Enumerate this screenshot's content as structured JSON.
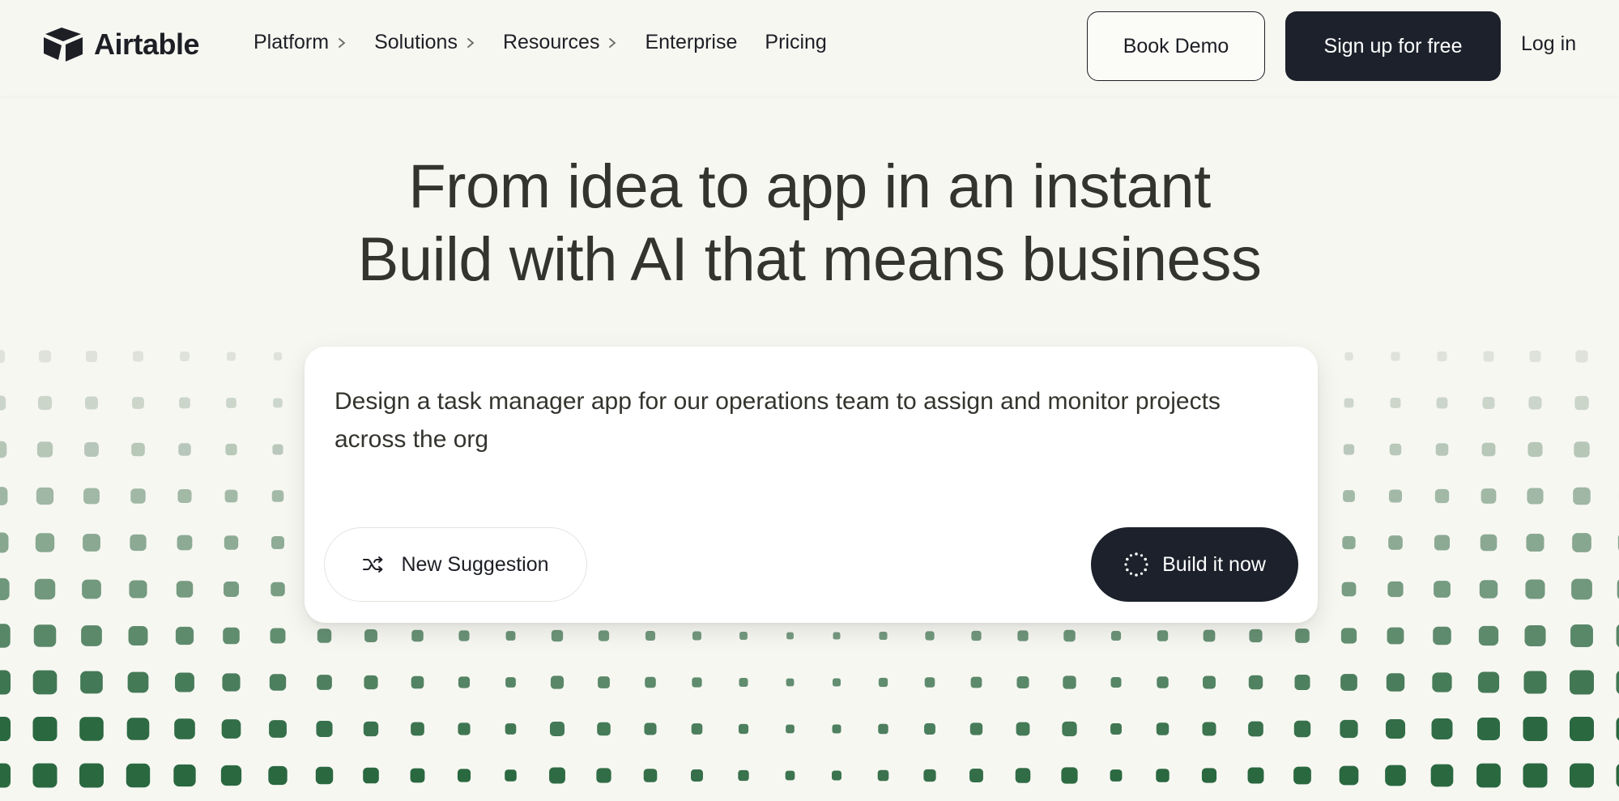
{
  "brand": {
    "name": "Airtable"
  },
  "nav": {
    "items": [
      {
        "label": "Platform",
        "has_submenu": true
      },
      {
        "label": "Solutions",
        "has_submenu": true
      },
      {
        "label": "Resources",
        "has_submenu": true
      },
      {
        "label": "Enterprise",
        "has_submenu": false
      },
      {
        "label": "Pricing",
        "has_submenu": false
      }
    ],
    "book_demo": "Book Demo",
    "signup": "Sign up for free",
    "login": "Log in"
  },
  "hero": {
    "line1": "From idea to app in an instant",
    "line2": "Build with AI that means business"
  },
  "prompt": {
    "text": "Design a task manager app for our operations team to assign and monitor projects across the org",
    "new_suggestion_label": "New Suggestion",
    "build_label": "Build it now"
  },
  "icons": {
    "logo": "airtable-logo-icon",
    "chevron": "chevron-right-icon",
    "shuffle": "shuffle-icon",
    "sparkle": "sparkle-loader-icon"
  },
  "colors": {
    "background": "#f7f7f2",
    "dark_button": "#1c212b",
    "dot_green": "#2e6b45",
    "dot_gray": "#dcdcd6"
  }
}
